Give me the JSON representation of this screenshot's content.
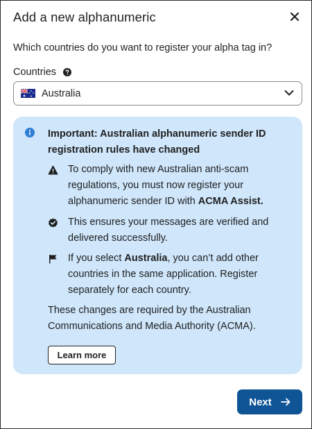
{
  "dialog": {
    "title": "Add a new alphanumeric",
    "question": "Which countries do you want to register your alpha tag in?",
    "countries_label": "Countries",
    "selected_country": "Australia",
    "notice": {
      "title": "Important: Australian alphanumeric sender ID registration rules have changed",
      "bullets": [
        {
          "icon": "warning-icon",
          "text_before": "To comply with new Australian anti-scam regulations, you must now register your alphanumeric sender ID with ",
          "bold": "ACMA Assist.",
          "text_after": ""
        },
        {
          "icon": "verified-check-icon",
          "text_before": "This ensures your messages are verified and delivered successfully.",
          "bold": "",
          "text_after": ""
        },
        {
          "icon": "flag-icon",
          "text_before": "If you select ",
          "bold": "Australia",
          "text_after": ", you can’t add other countries in the same application. Register separately for each country."
        }
      ],
      "footer": "These changes are required by the Australian Communications and Media Authority (ACMA).",
      "learn_more_label": "Learn more"
    },
    "next_label": "Next"
  },
  "colors": {
    "notice_bg": "#cfe6fb",
    "primary_button": "#0f5596",
    "info_icon": "#2f7fd6"
  },
  "icons": [
    "close-icon",
    "help-icon",
    "australia-flag-icon",
    "chevron-down-icon",
    "info-icon",
    "warning-icon",
    "verified-check-icon",
    "flag-icon",
    "arrow-right-icon"
  ]
}
